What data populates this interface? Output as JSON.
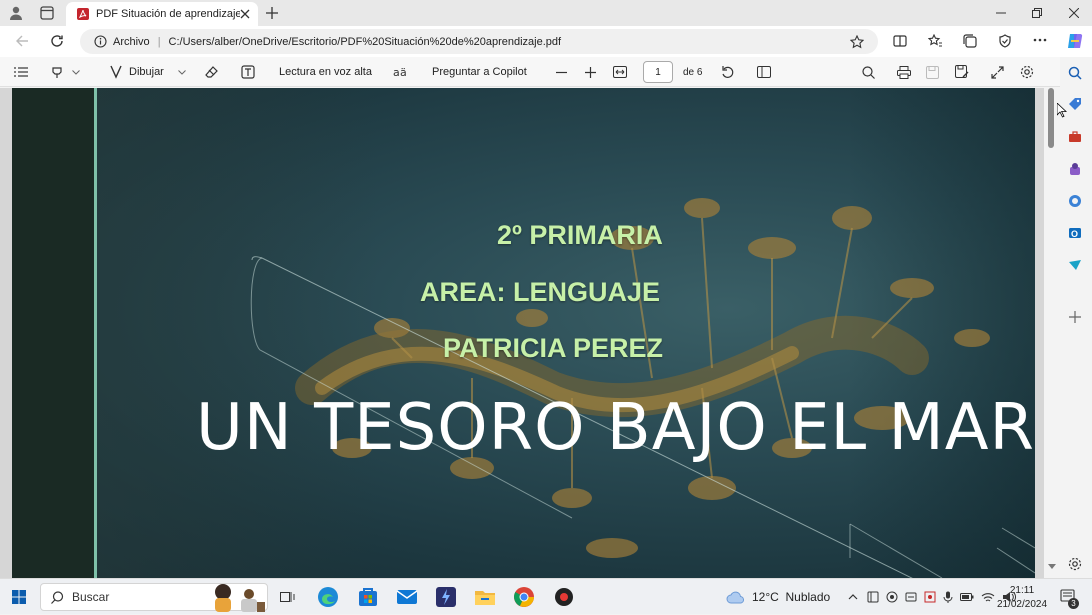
{
  "browser": {
    "tab_title": "PDF Situación de aprendizaje.pdf",
    "address_scheme_label": "Archivo",
    "url": "C:/Users/alber/OneDrive/Escritorio/PDF%20Situación%20de%20aprendizaje.pdf"
  },
  "pdf_toolbar": {
    "draw_label": "Dibujar",
    "read_aloud_label": "Lectura en voz alta",
    "ask_copilot_label": "Preguntar a Copilot",
    "current_page": "1",
    "page_total": "de 6"
  },
  "slide": {
    "grade": "2º PRIMARIA",
    "area": "AREA: LENGUAJE",
    "author": "PATRICIA PEREZ",
    "title": "UN TESORO BAJO EL MAR"
  },
  "taskbar": {
    "search_placeholder": "Buscar",
    "weather": "12°C  Nublado",
    "time": "21:11",
    "date": "21/02/2024",
    "notification_count": "3"
  },
  "colors": {
    "slide_accent": "#7fc1a9",
    "subtitle_text": "#c7f0a8",
    "pdf_tab_icon": "#c4262e"
  }
}
